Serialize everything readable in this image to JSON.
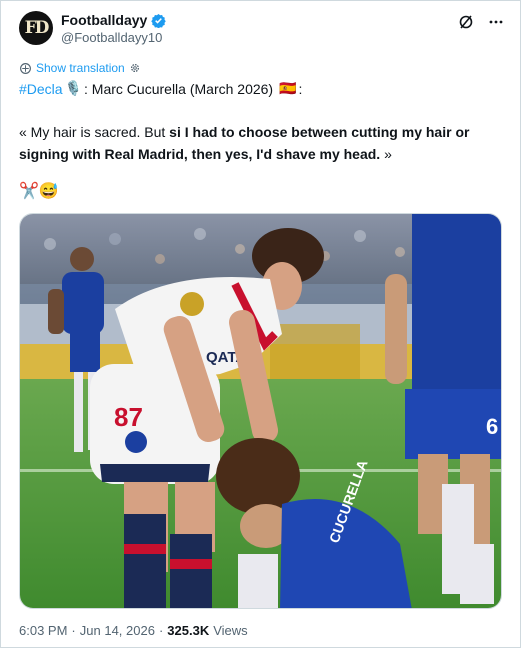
{
  "author": {
    "display_name": "Footballdayy",
    "handle": "@Footballdayy10",
    "avatar_text": "FD"
  },
  "header_icons": [
    "grok-icon",
    "more-icon"
  ],
  "translate": {
    "label": "Show translation"
  },
  "post": {
    "hashtag": "#Decla",
    "mic_emoji": "🎙️",
    "headline": ": Marc Cucurella (March 2026)",
    "flag_emoji": "🇪🇸",
    "headline_end": ":",
    "quote_plain": "« My hair is sacred. But ",
    "quote_bold": "si I had to choose between cutting my hair or signing with Real Madrid, then yes, I'd shave my head.",
    "quote_end": " »",
    "emojis": "✂️😅"
  },
  "media": {
    "jersey_number_left": "87",
    "jersey_name_right": "CUCURELLA",
    "sponsor_text": "QATAR"
  },
  "footer": {
    "time": "6:03 PM",
    "separator": "·",
    "date": "Jun 14, 2026",
    "separator2": "·",
    "views_count": "325.3K",
    "views_label": "Views"
  },
  "colors": {
    "accent": "#1d9bf0",
    "secondary_text": "#536471",
    "chelsea_blue": "#1b3fa0",
    "psg_red": "#c8102e",
    "pitch_green": "#4f9a3a"
  }
}
